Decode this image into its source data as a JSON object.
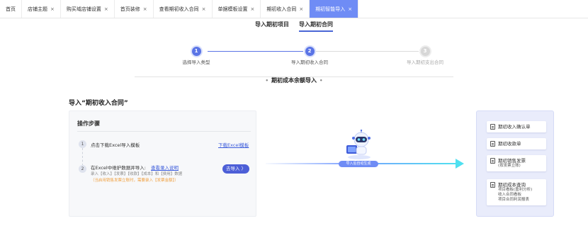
{
  "tabs": [
    {
      "label": "首页",
      "closable": false,
      "active": false
    },
    {
      "label": "店铺主题",
      "closable": true,
      "active": false
    },
    {
      "label": "购买域店铺设置",
      "closable": true,
      "active": false
    },
    {
      "label": "首页装修",
      "closable": true,
      "active": false
    },
    {
      "label": "查看期初收入合同",
      "closable": true,
      "active": false
    },
    {
      "label": "单据模板设置",
      "closable": true,
      "active": false
    },
    {
      "label": "期初收入合同",
      "closable": true,
      "active": false
    },
    {
      "label": "期初智能导入",
      "closable": true,
      "active": true
    }
  ],
  "close_glyph": "×",
  "subtabs": [
    {
      "label": "导入期初项目",
      "active": false
    },
    {
      "label": "导入期初合同",
      "active": true
    }
  ],
  "steps": [
    {
      "number": "1",
      "label": "选择导入类型",
      "state": "done"
    },
    {
      "number": "2",
      "label": "导入期初收入合同",
      "state": "current"
    },
    {
      "number": "3",
      "label": "导入期初支出合同",
      "state": "todo"
    }
  ],
  "section": {
    "title": "期初成本余额导入",
    "dot_left": "•",
    "dot_right": "•"
  },
  "import_title": "导入“期初收入合同”",
  "ops": {
    "title": "操作步骤",
    "step1": {
      "num": "1",
      "text": "点击下载Excel导入模板",
      "link": "下载Excel模板"
    },
    "step2": {
      "num": "2",
      "text": "在Excel中维护数据并导入:",
      "link": "查看录入说明",
      "sub": "录入【收入】【发票】【收款】【成本】和【费用】数据",
      "warn": "（当启用销售发票立账时，需要录入【发票金额】）",
      "button": "去导入 〉"
    }
  },
  "robot_label": "导入后自动生成",
  "accent_color": "#4d5fd7",
  "outputs": [
    {
      "title": "期初收入确认单",
      "lines": []
    },
    {
      "title": "期初收款单",
      "lines": []
    },
    {
      "title": "期初销售发票",
      "lines": [
        "(按发票立账)"
      ]
    },
    {
      "title": "期初成本查询",
      "lines": [
        "项目看板(盈利分析)",
        "收入合同看板",
        "项目合同利润报表"
      ]
    }
  ]
}
